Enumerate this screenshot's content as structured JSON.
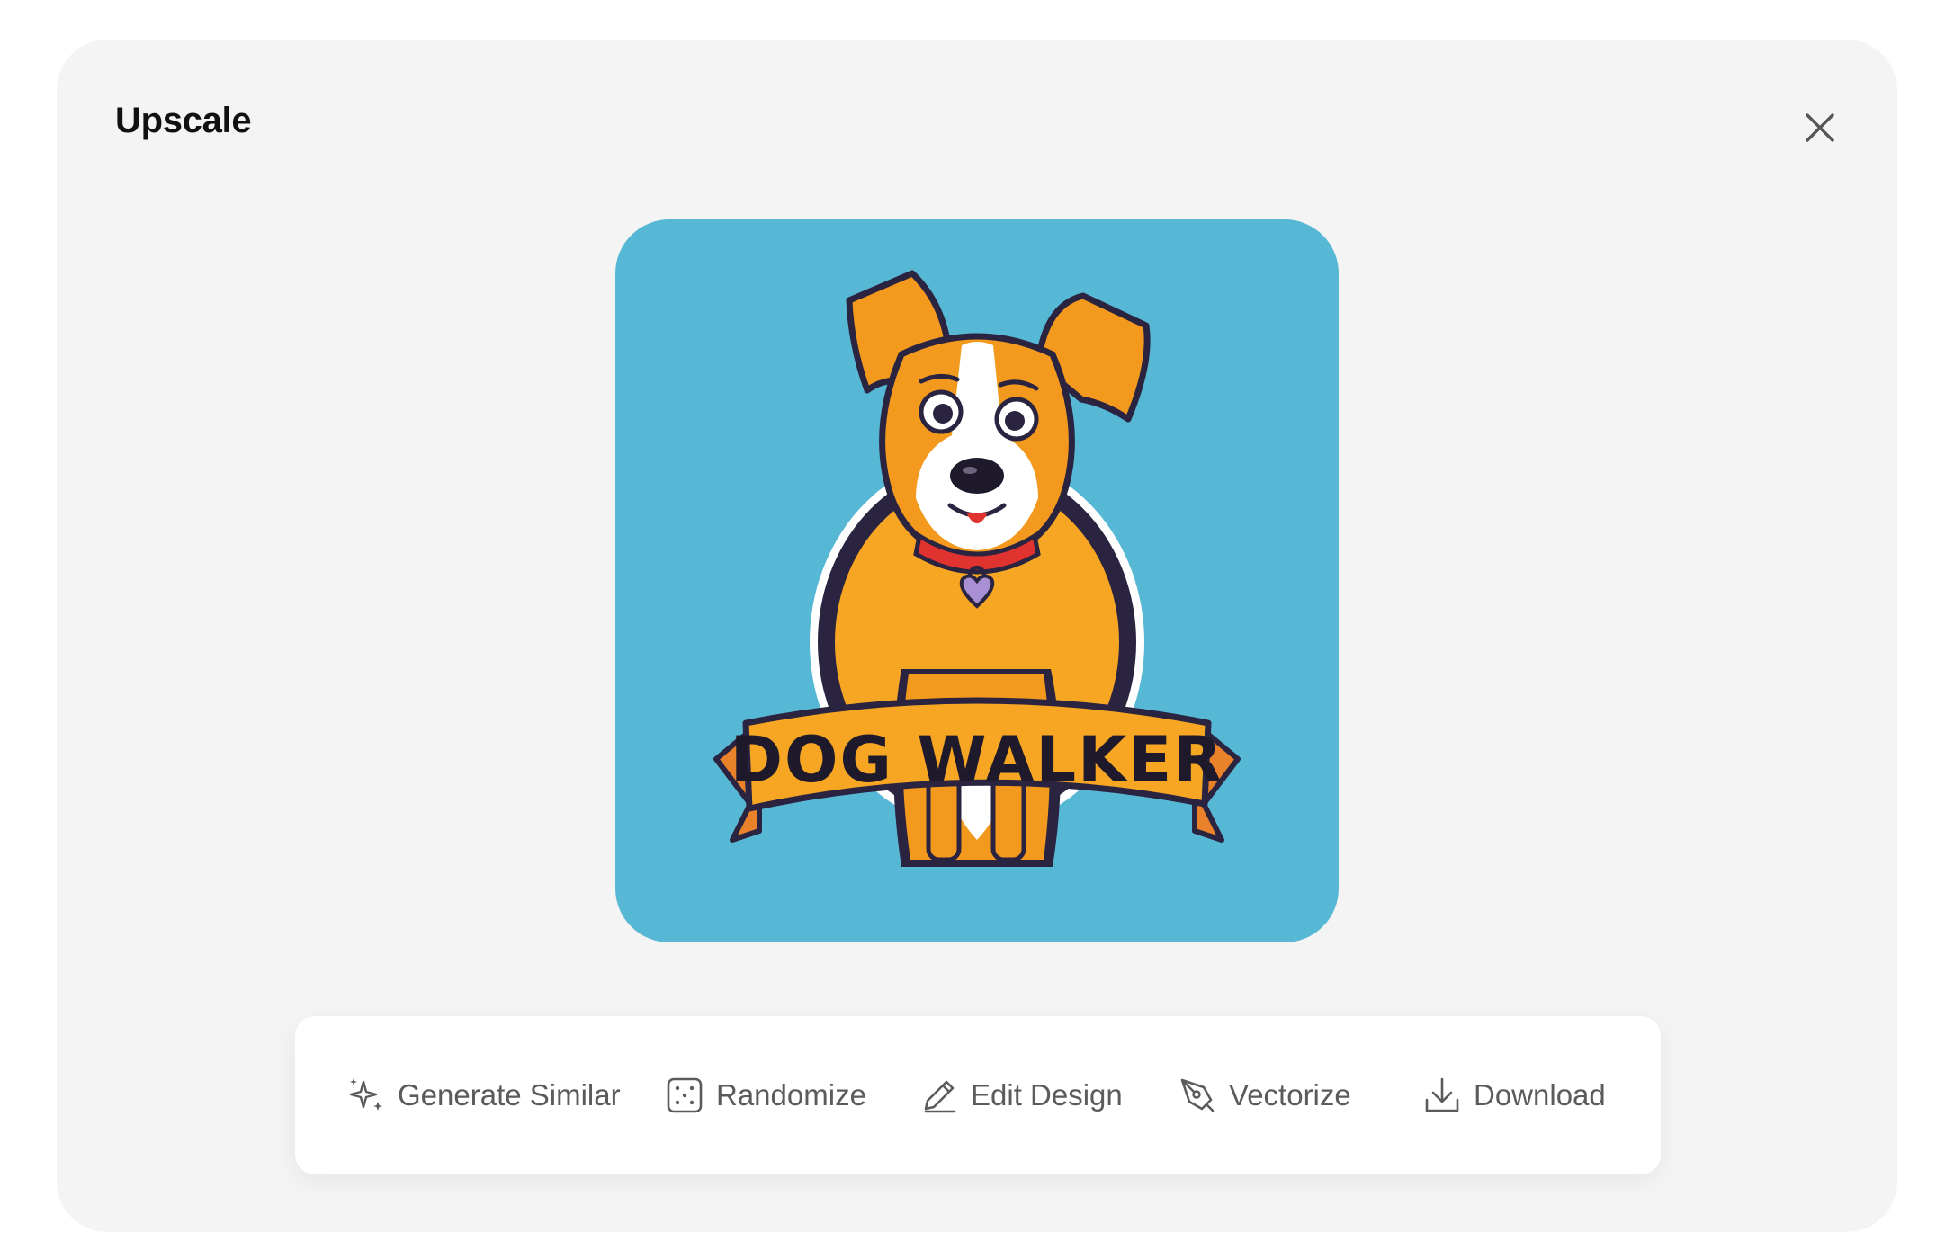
{
  "dialog": {
    "title": "Upscale",
    "close_icon": "close-icon"
  },
  "preview": {
    "logo_text": "DOG WALKER",
    "colors": {
      "background": "#57b8d5",
      "badge_circle": "#f6a623",
      "ribbon": "#f6a623",
      "outline": "#2b2440",
      "dog_fur": "#f39a1e",
      "collar": "#e0322f",
      "tag": "#a98fd4"
    }
  },
  "toolbar": {
    "buttons": [
      {
        "label": "Generate Similar",
        "icon": "sparkles-icon"
      },
      {
        "label": "Randomize",
        "icon": "dice-icon"
      },
      {
        "label": "Edit Design",
        "icon": "pencil-icon"
      },
      {
        "label": "Vectorize",
        "icon": "pen-tool-icon"
      },
      {
        "label": "Download",
        "icon": "download-icon"
      }
    ]
  },
  "colors": {
    "modal_background": "#f4f4f4",
    "toolbar_background": "#ffffff",
    "toolbar_text": "#5b5b5b",
    "title_text": "#111111"
  }
}
